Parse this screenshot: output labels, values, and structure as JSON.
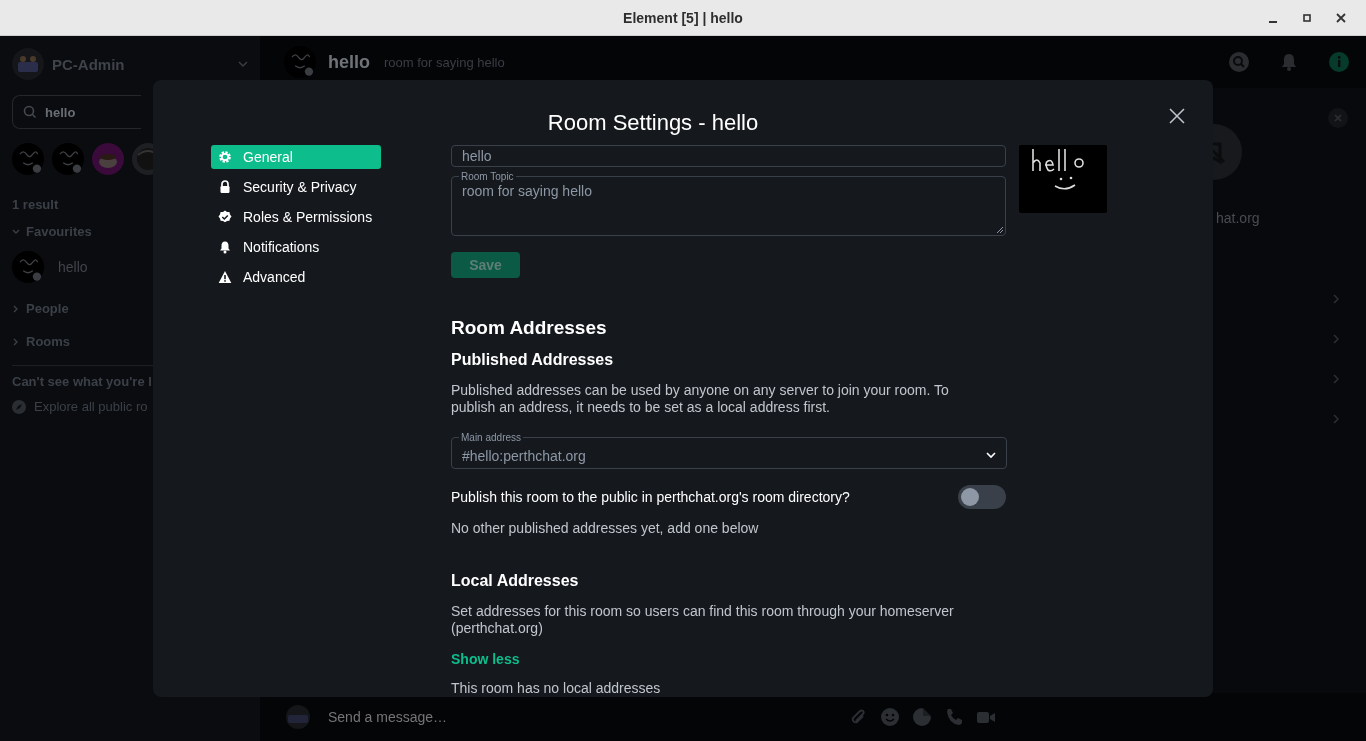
{
  "window": {
    "title": "Element [5] | hello"
  },
  "sidebar": {
    "user": "PC-Admin",
    "search": {
      "value": "hello"
    },
    "result_count": "1 result",
    "sections": [
      {
        "label": "Favourites",
        "expanded": true,
        "rooms": [
          {
            "name": "hello"
          }
        ]
      },
      {
        "label": "People",
        "expanded": false
      },
      {
        "label": "Rooms",
        "expanded": false
      }
    ],
    "hint": "Can't see what you're l",
    "explore": "Explore all public ro"
  },
  "room_header": {
    "name": "hello",
    "topic": "room for saying hello"
  },
  "composer": {
    "placeholder": "Send a message…"
  },
  "right_panel": {
    "server_fragment": "hat.org"
  },
  "dialog": {
    "title": "Room Settings - hello",
    "tabs": [
      {
        "label": "General",
        "kind": "gear",
        "selected": true
      },
      {
        "label": "Security & Privacy",
        "kind": "lock",
        "selected": false
      },
      {
        "label": "Roles & Permissions",
        "kind": "badge",
        "selected": false
      },
      {
        "label": "Notifications",
        "kind": "bell",
        "selected": false
      },
      {
        "label": "Advanced",
        "kind": "warning",
        "selected": false
      }
    ],
    "name_field": {
      "value": "hello"
    },
    "topic_field": {
      "label": "Room Topic",
      "value": "room for saying hello"
    },
    "save_button": {
      "label": "Save",
      "disabled": true
    },
    "addresses": {
      "heading": "Room Addresses",
      "published": {
        "heading": "Published Addresses",
        "description": "Published addresses can be used by anyone on any server to join your room. To publish an address, it needs to be set as a local address first.",
        "main_address": {
          "label": "Main address",
          "value": "#hello:perthchat.org"
        },
        "publish_toggle": {
          "label": "Publish this room to the public in perthchat.org's room directory?",
          "on": false
        },
        "empty_note": "No other published addresses yet, add one below"
      },
      "local": {
        "heading": "Local Addresses",
        "description": "Set addresses for this room so users can find this room through your homeserver (perthchat.org)",
        "toggle_link": "Show less",
        "empty_note": "This room has no local addresses"
      }
    }
  }
}
